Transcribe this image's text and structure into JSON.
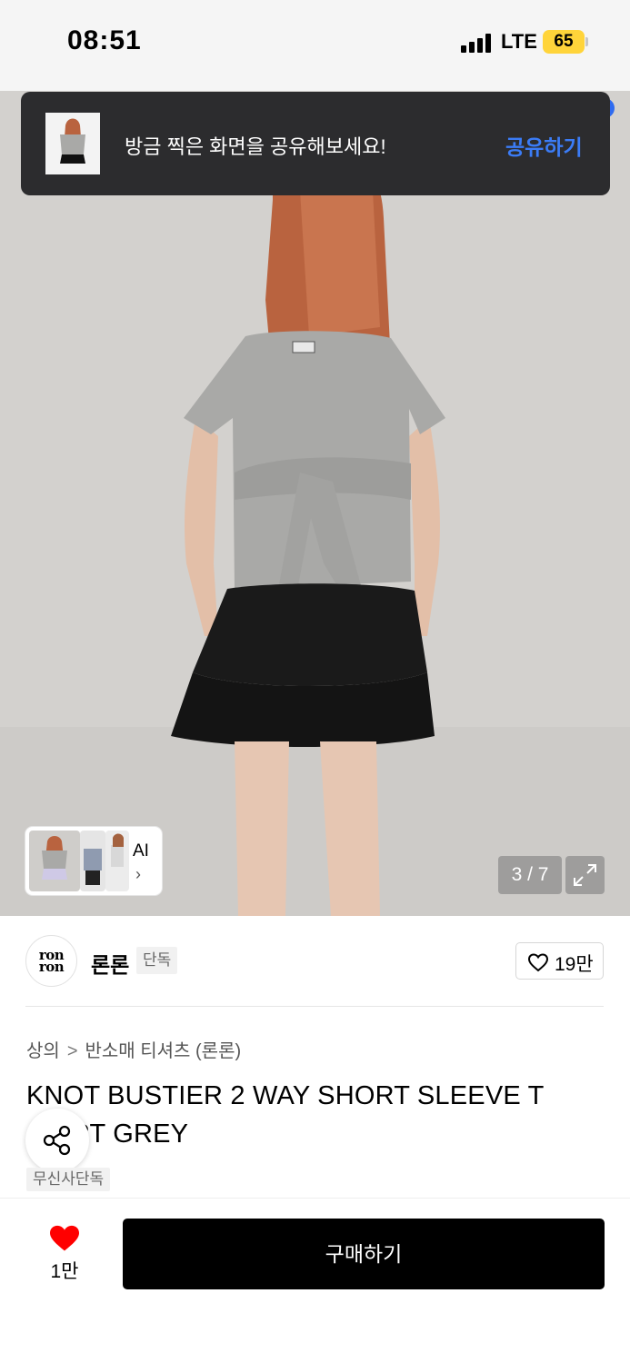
{
  "status_bar": {
    "time": "08:51",
    "network": "LTE",
    "battery": "65"
  },
  "toast": {
    "message": "방금 찍은 화면을 공유해보세요!",
    "action": "공유하기"
  },
  "gallery": {
    "ai_label": "AI",
    "ai_chevron": "›",
    "counter": "3 / 7"
  },
  "brand": {
    "logo_line1": "ron",
    "logo_line2": "ron",
    "name": "론론",
    "badge": "단독",
    "like_count": "19만"
  },
  "breadcrumb": {
    "category": "상의",
    "separator": ">",
    "subcategory": "반소매 티셔츠 (론론)"
  },
  "product": {
    "title": "KNOT BUSTIER 2 WAY SHORT SLEEVE T SHIRT GREY",
    "tag": "무신사단독"
  },
  "bottom_bar": {
    "wish_count": "1만",
    "buy_label": "구매하기"
  },
  "colors": {
    "accent": "#3b7cf6",
    "heart": "#ff0000",
    "buy_button": "#000000",
    "toast_bg": "#2c2c2e"
  }
}
